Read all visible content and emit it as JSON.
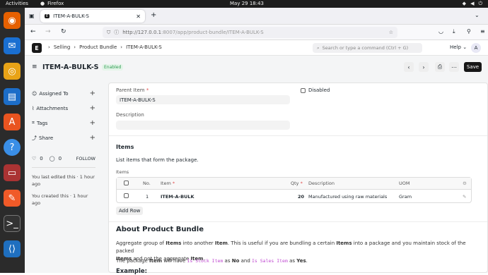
{
  "system": {
    "activities": "Activities",
    "app": "Firefox",
    "clock": "May 29  18:43"
  },
  "browser": {
    "tab_title": "ITEM-A-BULK-S",
    "url_host": "http://127.0.0.1",
    "url_path": ":8007/app/product-bundle/ITEM-A-BULK-S"
  },
  "app": {
    "logo": "E",
    "breadcrumbs": [
      "Selling",
      "Product Bundle",
      "ITEM-A-BULK-S"
    ],
    "search_placeholder": "Search or type a command (Ctrl + G)",
    "help": "Help",
    "avatar": "A"
  },
  "page": {
    "title": "ITEM-A-BULK-S",
    "status": "Enabled",
    "save": "Save"
  },
  "sidebar": {
    "items": [
      {
        "label": "Assigned To"
      },
      {
        "label": "Attachments"
      },
      {
        "label": "Tags"
      },
      {
        "label": "Share"
      }
    ],
    "likes": "0",
    "comments": "0",
    "follow": "FOLLOW",
    "edited_a": "You last edited this · 1 hour",
    "edited_b": "ago",
    "created_a": "You created this · 1 hour",
    "created_b": "ago"
  },
  "form": {
    "parent_item_label": "Parent Item",
    "parent_item_value": "ITEM-A-BULK-S",
    "disabled_label": "Disabled",
    "description_label": "Description",
    "items_section": "Items",
    "items_help": "List items that form the package.",
    "items_table_label": "Items",
    "columns": {
      "no": "No.",
      "item": "Item",
      "qty": "Qty",
      "description": "Description",
      "uom": "UOM"
    },
    "rows": [
      {
        "no": "1",
        "item": "ITEM-A-BULK",
        "qty": "20",
        "description": "Manufactured using raw materials",
        "uom": "Gram"
      }
    ],
    "add_row": "Add Row"
  },
  "about": {
    "heading": "About Product Bundle",
    "p1a": "Aggregate group of ",
    "p1b": "Items",
    "p1c": " into another ",
    "p1d": "Item",
    "p1e": ". This is useful if you are bundling a certain ",
    "p1f": "Items",
    "p1g": " into a package and you maintain stock of the packed",
    "p1h": "Items",
    "p1i": " and not the aggregate ",
    "p1j": "Item",
    "p1k": ".",
    "p2a": "The package ",
    "p2b": "Item",
    "p2c": " will have ",
    "p2d": "Is Stock Item",
    "p2e": " as ",
    "p2f": "No",
    "p2g": " and ",
    "p2h": "Is Sales Item",
    "p2i": " as ",
    "p2j": "Yes",
    "p2k": ".",
    "example": "Example:"
  }
}
